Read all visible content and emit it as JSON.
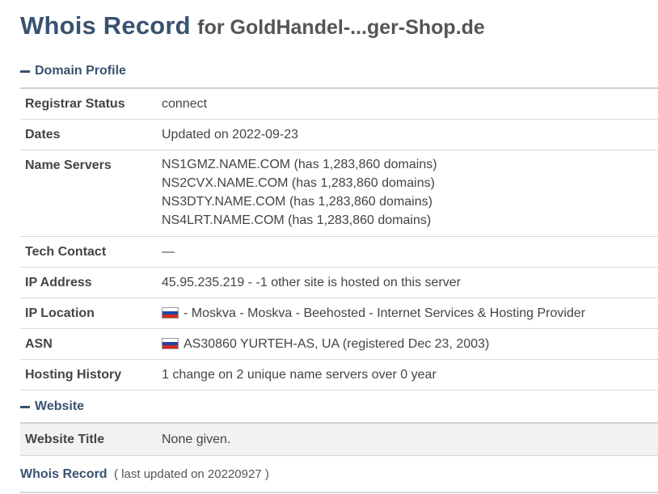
{
  "header": {
    "title": "Whois Record",
    "subtitle": "for GoldHandel-...ger-Shop.de"
  },
  "domain_profile": {
    "section_label": "Domain Profile",
    "rows": {
      "registrar_status": {
        "label": "Registrar Status",
        "value": "connect"
      },
      "dates": {
        "label": "Dates",
        "value": "Updated on 2022-09-23"
      },
      "name_servers": {
        "label": "Name Servers",
        "values": [
          "NS1GMZ.NAME.COM (has 1,283,860 domains)",
          "NS2CVX.NAME.COM (has 1,283,860 domains)",
          "NS3DTY.NAME.COM (has 1,283,860 domains)",
          "NS4LRT.NAME.COM (has 1,283,860 domains)"
        ]
      },
      "tech_contact": {
        "label": "Tech Contact",
        "value": "—"
      },
      "ip_address": {
        "label": "IP Address",
        "value": "45.95.235.219 - -1 other site is hosted on this server"
      },
      "ip_location": {
        "label": "IP Location",
        "value": "- Moskva - Moskva - Beehosted - Internet Services & Hosting Provider",
        "icon": "russia-flag-icon"
      },
      "asn": {
        "label": "ASN",
        "value": "AS30860 YURTEH-AS, UA (registered Dec 23, 2003)",
        "icon": "russia-flag-icon"
      },
      "hosting_history": {
        "label": "Hosting History",
        "value": "1 change on 2 unique name servers over 0 year"
      }
    }
  },
  "website": {
    "section_label": "Website",
    "rows": {
      "website_title": {
        "label": "Website Title",
        "value": "None given."
      }
    }
  },
  "footer": {
    "title": "Whois Record",
    "note": "( last updated on 20220927 )"
  },
  "colors": {
    "accent": "#385370",
    "border": "#d8d8d8",
    "row_alt": "#f2f2f2"
  }
}
